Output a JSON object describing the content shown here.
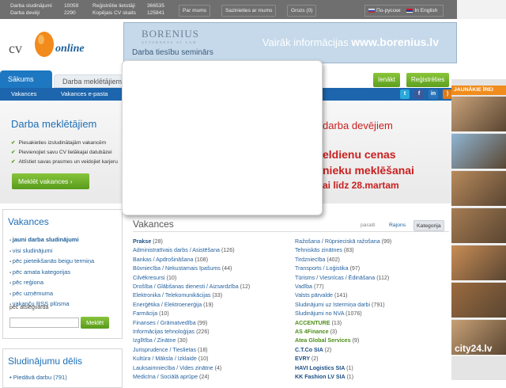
{
  "topbar": {
    "stats_left": [
      {
        "label": "Darba sludinājumi",
        "value": "10059"
      },
      {
        "label": "Darba devēji",
        "value": "2290"
      }
    ],
    "stats_right": [
      {
        "label": "Reģistrētie lietotāji",
        "value": "366535"
      },
      {
        "label": "Kopējais CV skaits",
        "value": "125841"
      }
    ],
    "links": [
      "Par mums",
      "Sazinieties ar mums",
      "Grozs (0)"
    ],
    "languages": [
      "По-русски",
      "In English"
    ]
  },
  "logo": {
    "text_cv": "cv",
    "text_online": "online"
  },
  "banner": {
    "brand": "BORENIUS",
    "brand_sub": "ATTORNEYS AT LAW",
    "ad_text": "Vairāk informācijas",
    "ad_url": "www.borenius.lv",
    "subtitle": "Darba tiesību seminārs"
  },
  "tabs": {
    "home": "Sākums",
    "employer": "Darba meklētājiem"
  },
  "actions": {
    "login": "Ienākt",
    "register": "Reģistrēties"
  },
  "nav": {
    "items": [
      "Vakances",
      "Vakances e-pasta"
    ]
  },
  "hero": {
    "title": "Darba meklētājiem",
    "bullets": [
      "Piesakieties izsludinātajām vakancēm",
      "Pievienojiet savu CV lielākajai datubāzei",
      "Attīstiet savas prasmes un veidojiet karjeru"
    ],
    "button": "Meklēt vakances",
    "right_title": "darba devējiem",
    "right_line1": "eldienu cenas",
    "right_line2": "nieku meklēšanai",
    "right_line3": "ai līdz 28.martam"
  },
  "left": {
    "title": "Vakances",
    "links": [
      "jauni darba sludinājumi",
      "visi sludinājumi",
      "pēc pieteikšanās beigu termiņa",
      "pēc amata kategorijas",
      "pēc reģiona",
      "pēc uzņēmuma",
      "vakanču RSS plūsma"
    ],
    "keyword_label": "pēc atslēgvārda",
    "search_button": "Meklēt",
    "board_title": "Sludinājumu dēlis",
    "board_link": "Piedāvā darbu (791)"
  },
  "main": {
    "title": "Vakances",
    "view_tabs": [
      "paraiti",
      "Rajons",
      "Kategorija"
    ],
    "col1": [
      {
        "name": "Prakse",
        "count": "(28)",
        "style": "b"
      },
      {
        "name": "Administratīvais darbs / Asistēšana",
        "count": "(126)"
      },
      {
        "name": "Bankas / Apdrošināšana",
        "count": "(108)"
      },
      {
        "name": "Būvniecība / Nekustamais īpašums",
        "count": "(44)"
      },
      {
        "name": "Cilvēkresursi",
        "count": "(10)"
      },
      {
        "name": "Drošība / Glābšanas dienesti / Aizsardzība",
        "count": "(12)"
      },
      {
        "name": "Elektronika / Telekomunikācijas",
        "count": "(33)"
      },
      {
        "name": "Enerģētika / Elektroenerģija",
        "count": "(19)"
      },
      {
        "name": "Farmācija",
        "count": "(10)"
      },
      {
        "name": "Finanses / Grāmatvedība",
        "count": "(99)"
      },
      {
        "name": "Informācijas tehnoloģijas",
        "count": "(226)"
      },
      {
        "name": "Izglītība / Zinātne",
        "count": "(30)"
      },
      {
        "name": "Jurisprudence / Tieslietas",
        "count": "(18)"
      },
      {
        "name": "Kultūra / Māksla / Izklaide",
        "count": "(10)"
      },
      {
        "name": "Lauksaimniecība / Vides zinātne",
        "count": "(4)"
      },
      {
        "name": "Medicīna / Sociālā aprūpe",
        "count": "(24)"
      }
    ],
    "col2": [
      {
        "name": "Ražošana / Rūpnieciskā ražošana",
        "count": "(99)"
      },
      {
        "name": "Tehniskās zinātnes",
        "count": "(83)"
      },
      {
        "name": "Tirdzniecība",
        "count": "(402)"
      },
      {
        "name": "Transports / Loģistika",
        "count": "(97)"
      },
      {
        "name": "Tūrisms / Viesnīcas / Ēdināšana",
        "count": "(112)"
      },
      {
        "name": "Vadība",
        "count": "(77)"
      },
      {
        "name": "Valsts pārvalde",
        "count": "(141)"
      },
      {
        "name": "Sludinājumi uz īstermiņa darbi",
        "count": "(791)"
      },
      {
        "name": "Sludinājumi no NVA",
        "count": "(1076)"
      },
      {
        "name": "ACCENTURE",
        "count": "(13)",
        "style": "g"
      },
      {
        "name": "AS 4Finance",
        "count": "(3)",
        "style": "g"
      },
      {
        "name": "Atea Global Services",
        "count": "(9)",
        "style": "g"
      },
      {
        "name": "C.T.Co SIA",
        "count": "(2)",
        "style": "b"
      },
      {
        "name": "EVRY",
        "count": "(2)",
        "style": "b"
      },
      {
        "name": "HAVI Logistics SIA",
        "count": "(1)",
        "style": "b"
      },
      {
        "name": "KK Fashion LV SIA",
        "count": "(1)",
        "style": "b"
      }
    ]
  },
  "sidebar": {
    "title": "JAUNĀKIE ĪREI",
    "brand": "city24.lv",
    "thumbs": [
      "#c9a27a",
      "#8fb6d4",
      "#b88a5c",
      "#a67c52",
      "#c98d56",
      "#9c6b3f",
      "#c8a176"
    ]
  }
}
